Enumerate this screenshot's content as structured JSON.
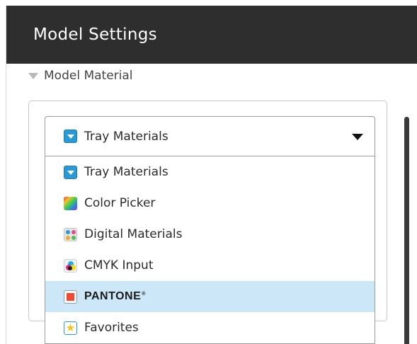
{
  "header": {
    "title": "Model Settings"
  },
  "section": {
    "label": "Model Material"
  },
  "material_select": {
    "selected_label": "Tray Materials"
  },
  "menu": {
    "items": [
      {
        "label": "Tray Materials",
        "icon": "tray-materials-icon"
      },
      {
        "label": "Color Picker",
        "icon": "color-picker-icon"
      },
      {
        "label": "Digital Materials",
        "icon": "digital-materials-icon"
      },
      {
        "label": "CMYK Input",
        "icon": "cmyk-input-icon"
      },
      {
        "label": "PANTONE",
        "icon": "pantone-icon",
        "highlighted": true
      },
      {
        "label": "Favorites",
        "icon": "favorites-star-icon"
      }
    ]
  },
  "colors": {
    "header_bg": "#2e2e2e",
    "highlight_bg": "#cce8f8",
    "tray_icon": "#2a9ad6",
    "pantone_swatch": "#f04a32",
    "favorite_star": "#f3c316"
  }
}
